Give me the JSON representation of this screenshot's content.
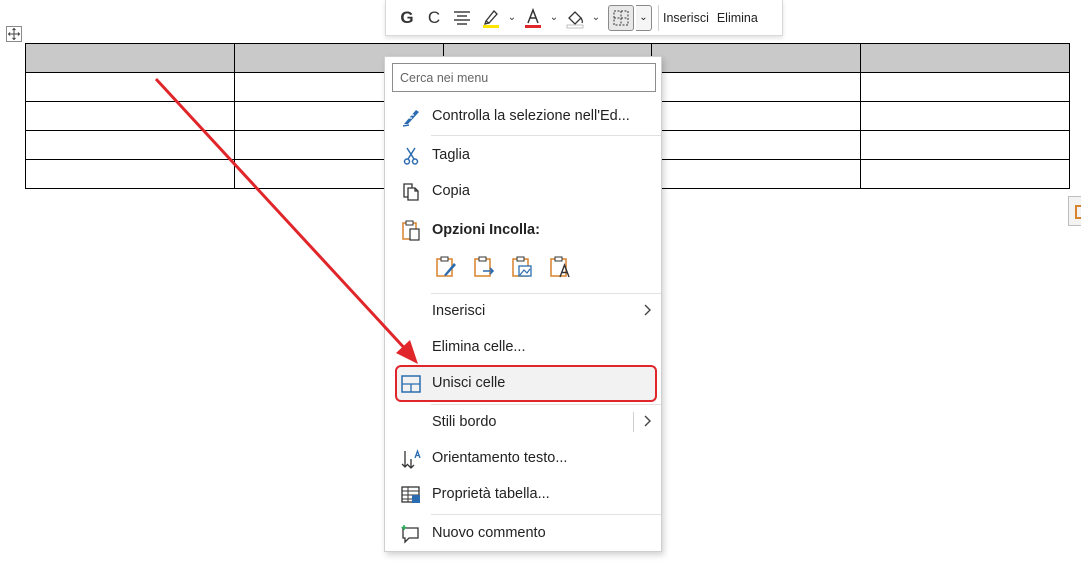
{
  "toolbar": {
    "bold_label": "G",
    "italic_label": "C",
    "insert_label": "Inserisci",
    "delete_label": "Elimina",
    "highlight_color": "#ffe600",
    "font_color": "#e0262a"
  },
  "menu": {
    "search_placeholder": "Cerca nei menu",
    "items": {
      "check_selection": "Controlla la selezione nell'Ed...",
      "cut": "Taglia",
      "copy": "Copia",
      "paste_options": "Opzioni Incolla:",
      "insert": "Inserisci",
      "delete_cells": "Elimina celle...",
      "merge_cells": "Unisci celle",
      "border_styles": "Stili bordo",
      "text_direction": "Orientamento testo...",
      "table_properties": "Proprietà tabella...",
      "new_comment": "Nuovo commento"
    }
  },
  "table": {
    "rows": 5,
    "cols": 5,
    "header_color": "#c9c9c9"
  },
  "colors": {
    "accent_red": "#e0262a",
    "icon_blue": "#2b6cb0",
    "icon_orange": "#d9822b"
  }
}
